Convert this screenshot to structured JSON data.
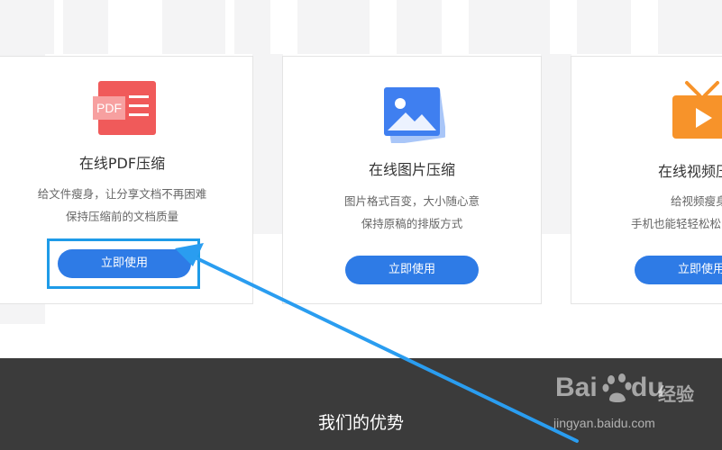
{
  "colors": {
    "accent": "#2e7be6",
    "pdf_icon": "#f05a5a",
    "image_icon": "#3f7ff0",
    "video_icon": "#f7932a",
    "dark_band": "#3b3b3b",
    "highlight": "#1e9be8"
  },
  "cards": [
    {
      "icon": "pdf-file-icon",
      "icon_text": "PDF",
      "title": "在线PDF压缩",
      "desc_line1": "给文件瘦身，让分享文档不再困难",
      "desc_line2": "保持压缩前的文档质量",
      "button_label": "立即使用"
    },
    {
      "icon": "image-icon",
      "title": "在线图片压缩",
      "desc_line1": "图片格式百变，大小随心意",
      "desc_line2": "保持原稿的排版方式",
      "button_label": "立即使用"
    },
    {
      "icon": "video-tv-icon",
      "title": "在线视频压",
      "desc_line1": "给视频瘦身",
      "desc_line2": "手机也能轻轻松松",
      "button_label": "立即使用"
    }
  ],
  "section": {
    "title": "我们的优势"
  },
  "watermark": {
    "brand_left": "Bai",
    "brand_right": "du",
    "suffix": "经验",
    "url": "jingyan.baidu.com"
  }
}
